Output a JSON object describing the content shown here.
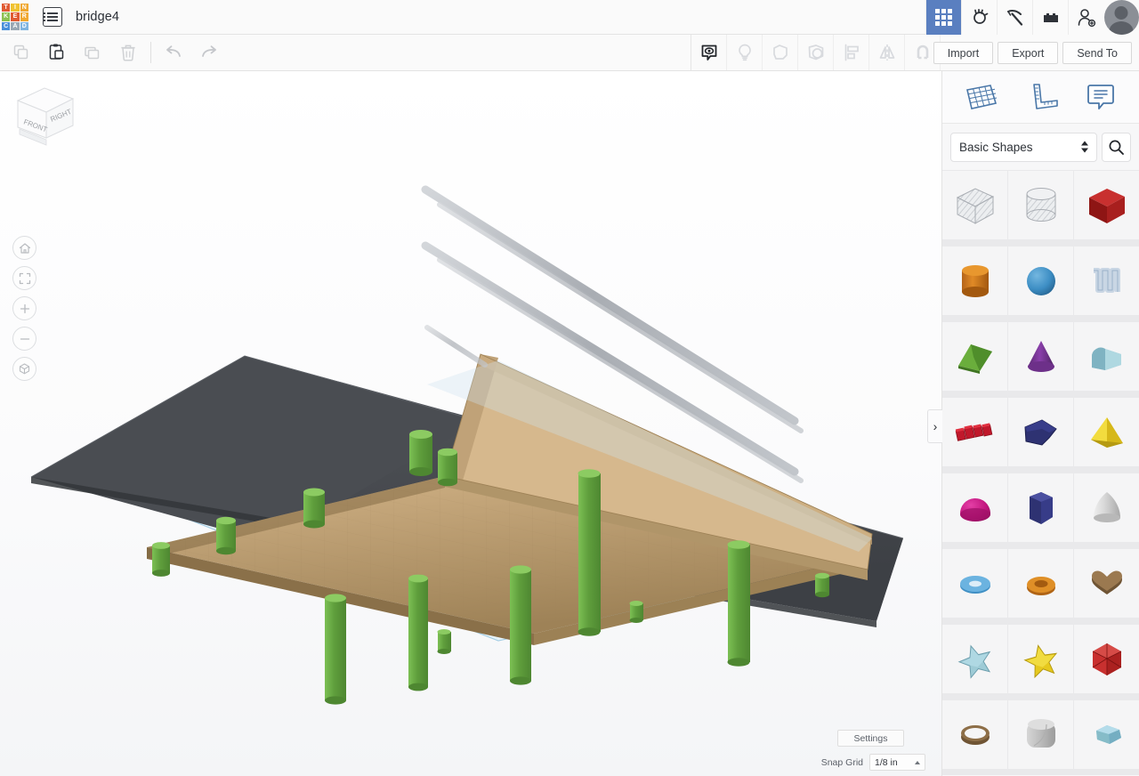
{
  "app": {
    "name": "Tinkercad",
    "logo_tiles": [
      {
        "letter": "T",
        "color": "#e05a33"
      },
      {
        "letter": "I",
        "color": "#f0c330"
      },
      {
        "letter": "N",
        "color": "#f0a830"
      },
      {
        "letter": "K",
        "color": "#8cc152"
      },
      {
        "letter": "E",
        "color": "#e05a33"
      },
      {
        "letter": "R",
        "color": "#f0a830"
      },
      {
        "letter": "C",
        "color": "#4a90d9"
      },
      {
        "letter": "A",
        "color": "#9aa7b4"
      },
      {
        "letter": "D",
        "color": "#7fb5e0"
      }
    ],
    "document_title": "bridge4",
    "document_icon": "list-menu-icon"
  },
  "topbar": {
    "right_icons": [
      {
        "name": "gallery-grid-icon",
        "label": "Gallery",
        "active": true
      },
      {
        "name": "tinkercad-design-icon",
        "label": "3D Designs",
        "active": false
      },
      {
        "name": "minecraft-pickaxe-icon",
        "label": "Minecraft",
        "active": false
      },
      {
        "name": "blocks-brick-icon",
        "label": "Blocks",
        "active": false
      },
      {
        "name": "add-user-icon",
        "label": "Invite",
        "active": false
      },
      {
        "name": "avatar",
        "label": "Account",
        "active": false
      }
    ]
  },
  "toolbar": {
    "left_buttons": [
      {
        "name": "copy-button",
        "label": "Copy",
        "enabled": false
      },
      {
        "name": "paste-button",
        "label": "Paste",
        "enabled": true
      },
      {
        "name": "duplicate-button",
        "label": "Duplicate",
        "enabled": false
      },
      {
        "name": "delete-button",
        "label": "Delete",
        "enabled": false
      },
      {
        "name": "undo-button",
        "label": "Undo",
        "enabled": false
      },
      {
        "name": "redo-button",
        "label": "Redo",
        "enabled": false
      }
    ],
    "middle_buttons": [
      {
        "name": "show-hide-button",
        "label": "Show / Hide",
        "enabled": true
      },
      {
        "name": "light-button",
        "label": "Light",
        "enabled": false
      },
      {
        "name": "shape-button",
        "label": "Shape",
        "enabled": false
      },
      {
        "name": "group-button",
        "label": "Group",
        "enabled": false
      },
      {
        "name": "align-button",
        "label": "Align",
        "enabled": false
      },
      {
        "name": "mirror-button",
        "label": "Mirror",
        "enabled": false
      },
      {
        "name": "magnet-button",
        "label": "Workplane Magnet",
        "enabled": false
      }
    ],
    "import_label": "Import",
    "export_label": "Export",
    "send_to_label": "Send To"
  },
  "canvas": {
    "view_cube": {
      "front_label": "FRONT",
      "right_label": "RIGHT"
    },
    "nav_buttons": [
      {
        "name": "home-view-button",
        "label": "Home View"
      },
      {
        "name": "fit-to-view-button",
        "label": "Fit all in view"
      },
      {
        "name": "zoom-in-button",
        "label": "Zoom in"
      },
      {
        "name": "zoom-out-button",
        "label": "Zoom out"
      },
      {
        "name": "orthographic-toggle-button",
        "label": "Switch to orthographic/perspective view"
      }
    ],
    "settings_label": "Settings",
    "snap_grid_label": "Snap Grid",
    "snap_grid_value": "1/8 in",
    "model": {
      "name": "bridge4",
      "parts": [
        {
          "name": "bridge-deck",
          "color": "#c9a87c"
        },
        {
          "name": "road-slab",
          "color": "#4a4d52"
        },
        {
          "name": "guardrail",
          "color": "#b0b4ba"
        },
        {
          "name": "support-pillars",
          "color": "#6aab44"
        },
        {
          "name": "workplane",
          "color": "#cfe8f5"
        }
      ]
    }
  },
  "right_panel": {
    "tabs": [
      {
        "name": "tab-shapes-grid",
        "label": "Shapes",
        "icon": "grid-workplane-icon"
      },
      {
        "name": "tab-ruler",
        "label": "Ruler",
        "icon": "ruler-icon"
      },
      {
        "name": "tab-notes",
        "label": "Notes",
        "icon": "note-comment-icon"
      }
    ],
    "category_value": "Basic Shapes",
    "search_placeholder": "Search",
    "collapse_label": "›",
    "shapes": [
      {
        "name": "box-hole",
        "label": "Box Hole",
        "color": "#c6c9ce"
      },
      {
        "name": "cylinder-hole",
        "label": "Cylinder Hole",
        "color": "#c6c9ce"
      },
      {
        "name": "box",
        "label": "Box",
        "color": "#b0201f"
      },
      {
        "name": "cylinder",
        "label": "Cylinder",
        "color": "#d9821f"
      },
      {
        "name": "sphere",
        "label": "Sphere",
        "color": "#3d8ec4"
      },
      {
        "name": "scribble",
        "label": "Scribble",
        "color": "#c9d6e4"
      },
      {
        "name": "roof-wedge",
        "label": "Roof",
        "color": "#5a9e33"
      },
      {
        "name": "cone",
        "label": "Cone",
        "color": "#71348c"
      },
      {
        "name": "round-roof",
        "label": "Round Roof",
        "color": "#86bcc8"
      },
      {
        "name": "text",
        "label": "Text",
        "color": "#c0182b"
      },
      {
        "name": "polygon-arrow",
        "label": "Polygon",
        "color": "#2b2f6e"
      },
      {
        "name": "pyramid",
        "label": "Pyramid",
        "color": "#e6c91e"
      },
      {
        "name": "half-sphere",
        "label": "Half Sphere",
        "color": "#c2157e"
      },
      {
        "name": "hex-prism",
        "label": "Hexagonal Prism",
        "color": "#2b2f6e"
      },
      {
        "name": "paraboloid",
        "label": "Paraboloid",
        "color": "#d8d8d8"
      },
      {
        "name": "torus",
        "label": "Torus",
        "color": "#4a9ed4"
      },
      {
        "name": "tube",
        "label": "Tube",
        "color": "#d9821f"
      },
      {
        "name": "heart",
        "label": "Heart",
        "color": "#8a6a43"
      },
      {
        "name": "star-blue",
        "label": "Star",
        "color": "#8fc3d6"
      },
      {
        "name": "star-yellow",
        "label": "Star",
        "color": "#e6c91e"
      },
      {
        "name": "polyhedron",
        "label": "Polyhedron",
        "color": "#b0201f"
      },
      {
        "name": "ring",
        "label": "Ring",
        "color": "#8a6a43"
      },
      {
        "name": "rounded-cylinder",
        "label": "Rounded Cylinder",
        "color": "#bdbdbd"
      },
      {
        "name": "gem",
        "label": "Gem",
        "color": "#86bcc8"
      }
    ]
  }
}
